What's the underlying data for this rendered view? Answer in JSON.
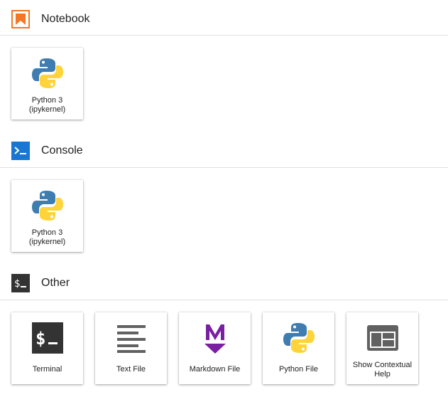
{
  "colors": {
    "notebook_icon": "#f37726",
    "console_icon": "#1976d2",
    "other_icon": "#333333",
    "markdown_icon": "#7b1fa2",
    "python_blue": "#3f7cb0",
    "python_yellow": "#ffd43b"
  },
  "sections": {
    "notebook": {
      "title": "Notebook",
      "icon": "bookmark-icon",
      "cards": [
        {
          "label": "Python 3\n(ipykernel)",
          "icon": "python-logo-icon"
        }
      ]
    },
    "console": {
      "title": "Console",
      "icon": "console-prompt-icon",
      "cards": [
        {
          "label": "Python 3\n(ipykernel)",
          "icon": "python-logo-icon"
        }
      ]
    },
    "other": {
      "title": "Other",
      "icon": "dollar-terminal-icon",
      "cards": [
        {
          "label": "Terminal",
          "icon": "terminal-icon"
        },
        {
          "label": "Text File",
          "icon": "text-lines-icon"
        },
        {
          "label": "Markdown File",
          "icon": "markdown-icon"
        },
        {
          "label": "Python File",
          "icon": "python-logo-icon"
        },
        {
          "label": "Show Contextual\nHelp",
          "icon": "contextual-help-icon"
        }
      ]
    }
  }
}
